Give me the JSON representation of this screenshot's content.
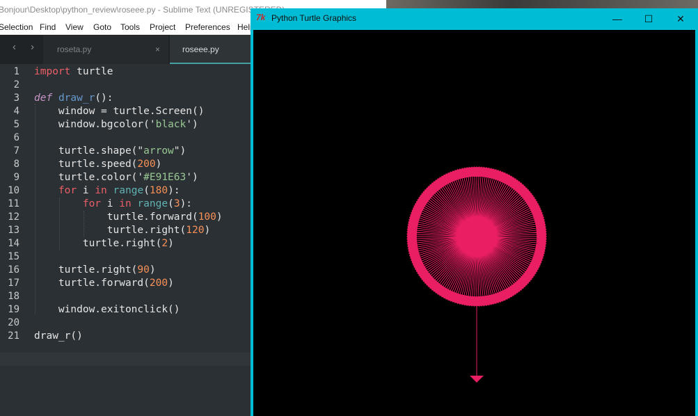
{
  "sublime": {
    "title": "Bonjour\\Desktop\\python_review\\roseee.py - Sublime Text (UNREGISTERED)",
    "menu": [
      "Selection",
      "Find",
      "View",
      "Goto",
      "Tools",
      "Project",
      "Preferences",
      "Help"
    ],
    "tabs": [
      {
        "label": "roseta.py",
        "active": false,
        "close": "×"
      },
      {
        "label": "roseee.py",
        "active": true
      }
    ],
    "nav_back": "‹",
    "nav_forward": "›",
    "line_numbers": [
      "1",
      "2",
      "3",
      "4",
      "5",
      "6",
      "7",
      "8",
      "9",
      "10",
      "11",
      "12",
      "13",
      "14",
      "15",
      "16",
      "17",
      "18",
      "19",
      "20",
      "21"
    ],
    "code_lines": [
      "import turtle",
      "",
      "def draw_r():",
      "    window = turtle.Screen()",
      "    window.bgcolor('black')",
      "",
      "    turtle.shape(\"arrow\")",
      "    turtle.speed(200)",
      "    turtle.color('#E91E63')",
      "    for i in range(180):",
      "        for i in range(3):",
      "            turtle.forward(100)",
      "            turtle.right(120)",
      "        turtle.right(2)",
      "",
      "    turtle.right(90)",
      "    turtle.forward(200)",
      "",
      "    window.exitonclick()",
      "",
      "draw_r()"
    ]
  },
  "turtle_window": {
    "title": "Python Turtle Graphics",
    "icon": "tkinter-icon",
    "minimize": "—",
    "maximize": "☐",
    "close": "✕",
    "drawing_color": "#E91E63",
    "background": "#000000",
    "triangles": 180,
    "rotation_step_degrees": 2,
    "triangle_side": 100
  },
  "colors": {
    "accent_teal": "#00bcd4",
    "pink": "#E91E63"
  }
}
